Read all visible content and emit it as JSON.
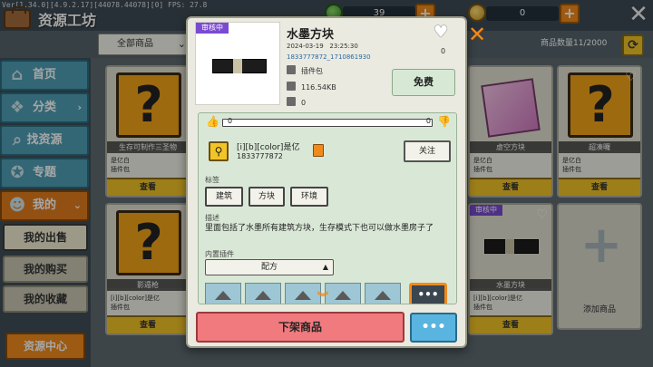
{
  "debug": {
    "text": "Ver[1.34.0][4.9.2.17][44078.44078][0] FPS: 27.8"
  },
  "header": {
    "title": "资源工坊",
    "currency1": "39",
    "currency2": "0"
  },
  "filter": {
    "dropdown_value": "全部商品",
    "count_label": "商品数量11/2000"
  },
  "sidebar": {
    "home": "首页",
    "category": "分类",
    "find": "找资源",
    "topic": "专题",
    "mine": "我的",
    "my_sale": "我的出售",
    "my_purchase": "我的购买",
    "my_fav": "我的收藏",
    "resource_center": "资源中心"
  },
  "grid": {
    "cards": [
      {
        "name": "生存可制作三圣物",
        "author": "是亿白",
        "type": "插件包",
        "view": "查看"
      },
      {
        "name": "虚空方块",
        "author": "是亿白",
        "type": "插件包",
        "view": "查看"
      },
      {
        "name": "超凑曪",
        "author": "是亿白",
        "type": "插件包",
        "view": "查看"
      },
      {
        "name": "影遁枪",
        "author": "[i][b][color]是亿",
        "type": "插件包",
        "view": "查看"
      },
      {
        "name": "水墨方块",
        "author": "[i][b][color]是亿",
        "type": "插件包",
        "view": "查看",
        "status": "审核中"
      }
    ],
    "add_label": "添加商品"
  },
  "dialog": {
    "status_tag": "审核中",
    "title": "水墨方块",
    "date": "2024-03-19",
    "time": "23:25:30",
    "id": "1833777872_1710861930",
    "type": "插件包",
    "size": "116.54KB",
    "downloads": "0",
    "favorites": "0",
    "price_btn": "免费",
    "likes": "0",
    "dislikes": "0",
    "author_name": "[i][b][color]是亿",
    "author_id": "1833777872",
    "follow": "关注",
    "tags_label": "标签",
    "tags": [
      "建筑",
      "方块",
      "环境"
    ],
    "desc_label": "描述",
    "desc": "里面包括了水墨所有建筑方块，生存模式下也可以做水墨房子了",
    "builtin_label": "内置插件",
    "builtin_select": "配方",
    "remove_btn": "下架商品",
    "more_btn": "•••"
  }
}
